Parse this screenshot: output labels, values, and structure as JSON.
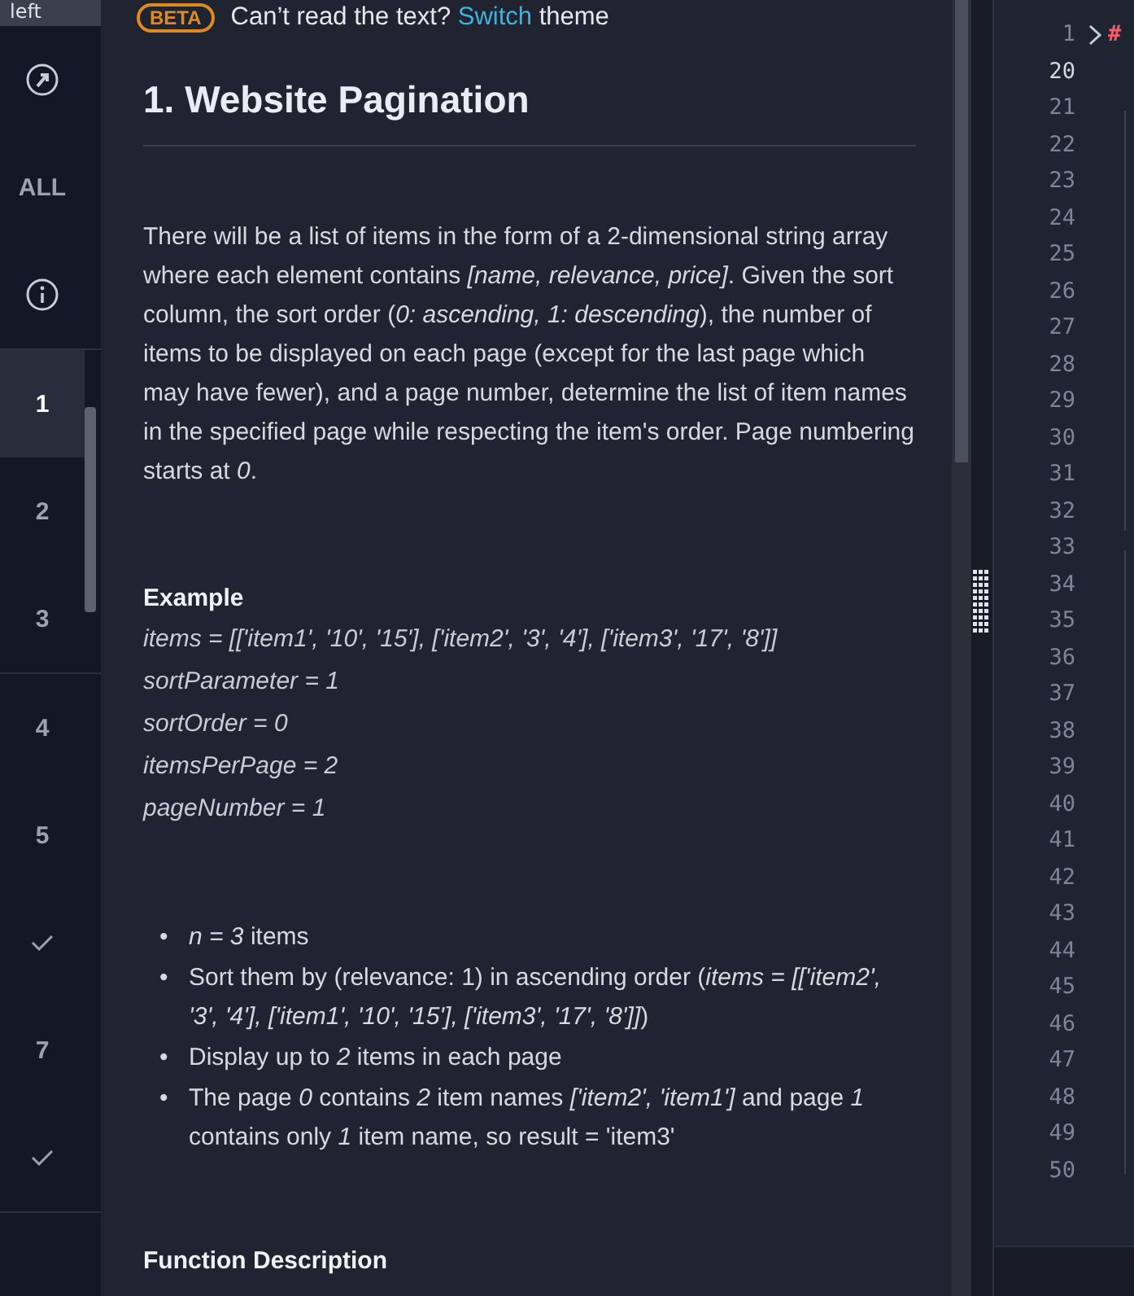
{
  "sidebar": {
    "top_label": "left",
    "items": [
      {
        "kind": "arrow",
        "selected": false
      },
      {
        "kind": "text",
        "label": "ALL",
        "selected": false
      },
      {
        "kind": "info",
        "selected": false
      },
      {
        "kind": "text",
        "label": "1",
        "selected": true
      },
      {
        "kind": "text",
        "label": "2",
        "selected": false
      },
      {
        "kind": "text",
        "label": "3",
        "selected": false
      },
      {
        "kind": "text",
        "label": "4",
        "selected": false
      },
      {
        "kind": "text",
        "label": "5",
        "selected": false
      },
      {
        "kind": "check",
        "selected": false
      },
      {
        "kind": "text",
        "label": "7",
        "selected": false
      },
      {
        "kind": "check",
        "selected": false
      }
    ]
  },
  "banner": {
    "badge": "BETA",
    "text": "Can’t read the text?",
    "link": "Switch",
    "after": "theme"
  },
  "problem": {
    "title": "1. Website Pagination",
    "description": "There will be a list of items in the form of a 2-dimensional string array where each element contains *[name, relevance, price]*.  Given the sort column, the sort order (*0: ascending, 1: descending*), the number of items to be displayed on each page (except for the last page which may have fewer), and a page number, determine the list of item names in the specified page while respecting the item's order. Page numbering starts at *0*.",
    "example_heading": "Example",
    "example_lines": [
      "items = [['item1', '10', '15'], ['item2', '3', '4'], ['item3', '17', '8']]",
      "sortParameter = 1",
      "sortOrder = 0",
      "itemsPerPage = 2",
      "pageNumber = 1"
    ],
    "bullets": [
      {
        "marker": "•",
        "text": "*n = 3* items"
      },
      {
        "marker": "•",
        "text": "Sort them by (relevance: 1) in ascending order (*items = [['item2', '3', '4'], ['item1', '10', '15'], ['item3', '17', '8']]*)"
      },
      {
        "marker": "•",
        "text": "Display up to *2* items in each page"
      },
      {
        "marker": "•",
        "text": "The page *0* contains *2* item names *['item2', 'item1']* and page *1* contains only *1* item name, so result = 'item3'"
      }
    ],
    "section_heading": "Function Description"
  },
  "editor": {
    "first_line": "1",
    "first_code": "#",
    "line_numbers": [
      "20",
      "21",
      "22",
      "23",
      "24",
      "25",
      "26",
      "27",
      "28",
      "29",
      "30",
      "31",
      "32",
      "33",
      "34",
      "35",
      "36",
      "37",
      "38",
      "39",
      "40",
      "41",
      "42",
      "43",
      "44",
      "45",
      "46",
      "47",
      "48",
      "49",
      "50"
    ]
  }
}
